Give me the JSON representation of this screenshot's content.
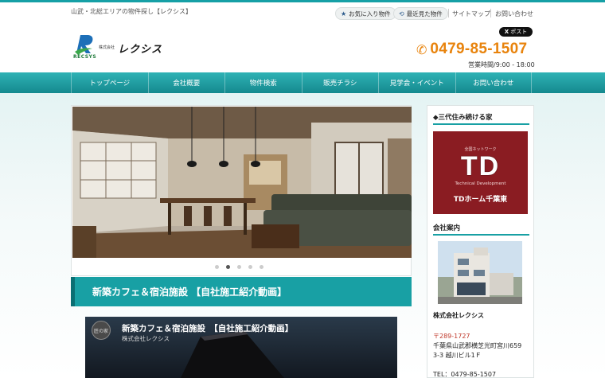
{
  "header": {
    "tagline": "山武・北総エリアの物件探し【レクシス】",
    "favorites_label": "お気に入り物件",
    "recent_label": "最近見た物件",
    "sitemap_label": "サイトマップ",
    "contact_label": "お問い合わせ",
    "x_post_label": "ポスト",
    "phone": "0479-85-1507",
    "hours": "営業時間/9:00 - 18:00",
    "logo": {
      "en": "RECSYS",
      "kabu": "株式会社",
      "jp": "レクシス"
    }
  },
  "nav": {
    "items": [
      {
        "label": "トップページ"
      },
      {
        "label": "会社概要"
      },
      {
        "label": "物件検索"
      },
      {
        "label": "販売チラシ"
      },
      {
        "label": "見学会・イベント"
      },
      {
        "label": "お問い合わせ"
      }
    ]
  },
  "slider": {
    "total_slides": 5,
    "active_index": 1
  },
  "main": {
    "section_title": "新築カフェ＆宿泊施設 【自社施工紹介動画】",
    "video": {
      "title": "新築カフェ＆宿泊施設　【自社施工紹介動画】",
      "subtitle": "株式会社レクシス",
      "channel_badge": "匠の家"
    }
  },
  "sidebar": {
    "heading1": "◆三代住み続ける家",
    "banner": {
      "small": "全国ネットワーク",
      "big": "TD",
      "en": "Technical  Development",
      "name": "TDホーム千葉東"
    },
    "heading2": "会社案内",
    "company_name": "株式会社レクシス",
    "postal": "〒289-1727",
    "address1": "千葉県山武郡横芝光町宮川659",
    "address2": "3-3 越川ビル1Ｆ",
    "tel": "TEL：0479-85-1507"
  },
  "colors": {
    "accent": "#18a0a4",
    "phone": "#e8830c",
    "banner": "#8a1c22"
  }
}
